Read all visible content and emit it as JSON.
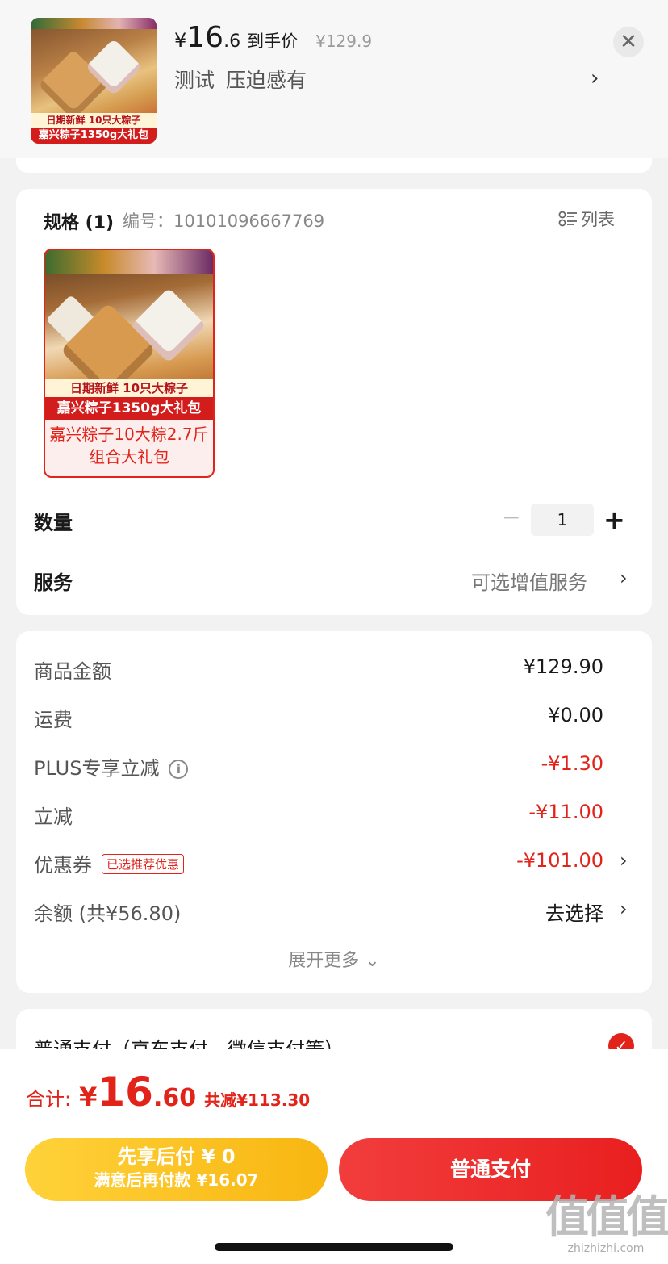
{
  "header": {
    "thumb_caption_1": "日期新鲜 10只大粽子",
    "thumb_caption_2": "嘉兴粽子1350g大礼包",
    "price_symbol": "¥",
    "price_int": "16",
    "price_dec": ".6",
    "price_label": "到手价",
    "original_price": "¥129.9",
    "sku_parts": [
      "测试",
      "压迫感有"
    ],
    "sku_chevron": "›",
    "close": "✕"
  },
  "spec": {
    "title": "规格 (1)",
    "number": "编号：10101096667769",
    "list_toggle": "列表",
    "variant": {
      "caption_1": "日期新鲜 10只大粽子",
      "caption_2": "嘉兴粽子1350g大礼包",
      "name": "嘉兴粽子10大粽2.7斤组合大礼包"
    },
    "quantity_label": "数量",
    "quantity_minus": "−",
    "quantity_value": "1",
    "quantity_plus": "+",
    "service_label": "服务",
    "service_value": "可选增值服务",
    "chevron": "›"
  },
  "summary": {
    "rows": [
      {
        "label": "商品金额",
        "value": "¥129.90"
      },
      {
        "label": "运费",
        "value": "¥0.00"
      },
      {
        "label": "PLUS专享立减",
        "info": "i",
        "value": "-¥1.30"
      },
      {
        "label": "立减",
        "value": "-¥11.00"
      },
      {
        "label": "优惠券",
        "tag": "已选推荐优惠",
        "value": "-¥101.00"
      },
      {
        "label": "余额 (共¥56.80)",
        "value": "去选择"
      }
    ],
    "expand": "展开更多 ⌄"
  },
  "payment": {
    "method": "普通支付（京东支付、微信支付等）",
    "check": "✓"
  },
  "footer": {
    "total_label": "合计:",
    "total_symbol": "¥",
    "total_int": "16",
    "total_dec": ".60",
    "saved": "共减¥113.30",
    "pay_later_line1": "先享后付 ¥ 0",
    "pay_later_line2": "满意后再付款 ¥16.07",
    "pay_now": "普通支付"
  },
  "watermark": {
    "mark": "值值值",
    "url": "zhizhizhi.com"
  },
  "colors": {
    "accent_red": "#e2231a",
    "yellow_button": "#f8b611"
  }
}
